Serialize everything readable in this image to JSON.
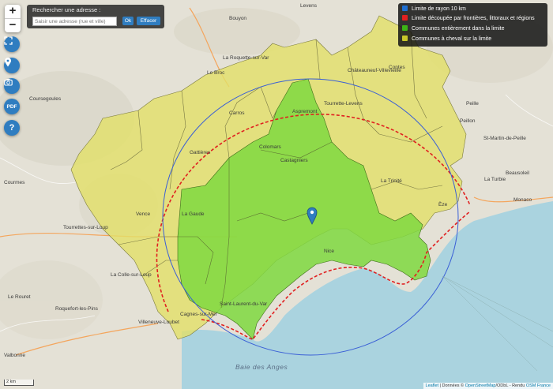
{
  "search": {
    "label": "Rechercher une adresse :",
    "placeholder": "Saisir une adresse (rue et ville)",
    "ok_label": "Ok",
    "clear_label": "Effacer"
  },
  "controls": {
    "zoom_in": "+",
    "zoom_out": "−",
    "pdf": "PDF",
    "help": "?"
  },
  "legend": [
    {
      "label": "Limite de rayon 10 km",
      "color": "#1f6fd1"
    },
    {
      "label": "Limite découpée par frontières, littoraux et régions",
      "color": "#e02020"
    },
    {
      "label": "Communes entièrement dans la limite",
      "color": "#3db516"
    },
    {
      "label": "Communes à cheval sur la limite",
      "color": "#c8c72a"
    }
  ],
  "places": {
    "bouyon": "Bouyon",
    "levens": "Levens",
    "roquette": "La Roquette-sur-Var",
    "broc": "Le Broc",
    "coursegoules": "Coursegoules",
    "gattieres": "Gattières",
    "carros": "Carros",
    "aspremont": "Aspremont",
    "tourrette": "Tourrette-Levens",
    "chateauneuf": "Châteauneuf-Villevieille",
    "contes": "Contes",
    "peillon": "Peillon",
    "peille": "Peille",
    "saintmartin": "St-Martin-de-Peille",
    "turbie": "La Turbie",
    "beausoleil": "Beausoleil",
    "monaco": "Monaco",
    "eze": "Èze",
    "trinite": "La Trinité",
    "vence": "Vence",
    "gaude": "La Gaude",
    "colomars": "Colomars",
    "castagniers": "Castagniers",
    "nice": "Nice",
    "tourrettes": "Tourrettes-sur-Loup",
    "collesurloup": "La Colle-sur-Loup",
    "roquefort": "Roquefort-les-Pins",
    "cagnes": "Cagnes-sur-Mer",
    "saintlaurent": "Saint-Laurent-du-Var",
    "villeneuve": "Villeneuve-Loubet",
    "valbonne": "Valbonne",
    "rouret": "Le Rouret",
    "courmes": "Courmes",
    "bay": "Baie des Anges"
  },
  "attribution": {
    "leaflet": "Leaflet",
    "text": " | Données © ",
    "osm": "OpenStreetMap",
    "text2": "/ODbL - Rendu ",
    "osmfr": "OSM France"
  },
  "scale_label": "2 km"
}
